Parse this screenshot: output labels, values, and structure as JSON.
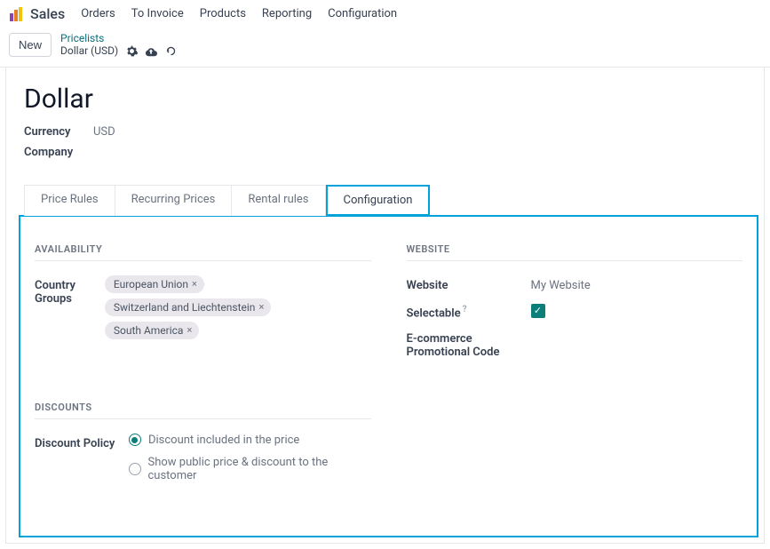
{
  "nav": {
    "brand": "Sales",
    "items": [
      "Orders",
      "To Invoice",
      "Products",
      "Reporting",
      "Configuration"
    ]
  },
  "actions": {
    "new": "New"
  },
  "breadcrumb": {
    "parent": "Pricelists",
    "current": "Dollar (USD)"
  },
  "record": {
    "title": "Dollar",
    "currency_label": "Currency",
    "currency_value": "USD",
    "company_label": "Company"
  },
  "tabs": [
    "Price Rules",
    "Recurring Prices",
    "Rental rules",
    "Configuration"
  ],
  "active_tab": 3,
  "config": {
    "availability_h": "AVAILABILITY",
    "country_groups_label": "Country Groups",
    "country_groups": [
      "European Union",
      "Switzerland and Liechtenstein",
      "South America"
    ],
    "discounts_h": "DISCOUNTS",
    "discount_policy_label": "Discount Policy",
    "discount_options": [
      "Discount included in the price",
      "Show public price & discount to the customer"
    ],
    "discount_selected": 0,
    "website_h": "WEBSITE",
    "website_label": "Website",
    "website_value": "My Website",
    "selectable_label": "Selectable",
    "selectable_value": true,
    "ecom_code_label": "E-commerce Promotional Code"
  }
}
